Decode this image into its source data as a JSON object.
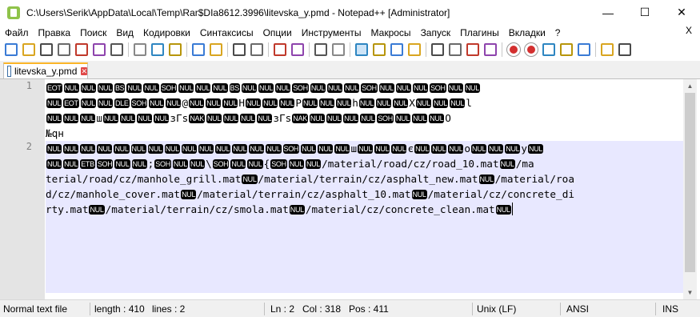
{
  "window": {
    "title": "C:\\Users\\Serik\\AppData\\Local\\Temp\\Rar$DIa8612.3996\\litevska_y.pmd - Notepad++ [Administrator]",
    "minimize": "—",
    "maximize": "☐",
    "close": "✕"
  },
  "menu": {
    "items": [
      "Файл",
      "Правка",
      "Поиск",
      "Вид",
      "Кодировки",
      "Синтаксисы",
      "Опции",
      "Инструменты",
      "Макросы",
      "Запуск",
      "Плагины",
      "Вкладки",
      "?"
    ],
    "close_doc": "X"
  },
  "toolbar": {
    "icons": [
      "new-file-icon",
      "open-file-icon",
      "save-icon",
      "save-all-icon",
      "close-icon",
      "close-all-icon",
      "print-icon",
      "cut-icon",
      "copy-icon",
      "paste-icon",
      "undo-icon",
      "redo-icon",
      "find-icon",
      "replace-icon",
      "zoom-in-icon",
      "zoom-out-icon",
      "sync-vertical-icon",
      "sync-horizontal-icon",
      "word-wrap-icon",
      "show-all-chars-icon",
      "indent-guide-icon",
      "udl-icon",
      "doc-map-icon",
      "function-list-icon",
      "folder-as-workspace-icon",
      "monitoring-icon",
      "record-macro-icon",
      "stop-record-icon",
      "play-macro-icon",
      "play-multiple-icon",
      "save-macro-icon",
      "spell-check-icon",
      "plugin-icon"
    ],
    "accent": "#2b6cb0"
  },
  "tab": {
    "label": "litevska_y.pmd",
    "close": "✕"
  },
  "editor": {
    "line_numbers": [
      "1",
      "2"
    ],
    "rows": [
      [
        [
          "c",
          "EOT"
        ],
        [
          "c",
          "NUL"
        ],
        [
          "c",
          "NUL"
        ],
        [
          "c",
          "NUL"
        ],
        [
          "c",
          "BS"
        ],
        [
          "c",
          "NUL"
        ],
        [
          "c",
          "NUL"
        ],
        [
          "c",
          "SOH"
        ],
        [
          "c",
          "NUL"
        ],
        [
          "c",
          "NUL"
        ],
        [
          "c",
          "NUL"
        ],
        [
          "c",
          "BS"
        ],
        [
          "c",
          "NUL"
        ],
        [
          "c",
          "NUL"
        ],
        [
          "c",
          "NUL"
        ],
        [
          "c",
          "SOH"
        ],
        [
          "c",
          "NUL"
        ],
        [
          "c",
          "NUL"
        ],
        [
          "c",
          "NUL"
        ],
        [
          "c",
          "SOH"
        ],
        [
          "c",
          "NUL"
        ],
        [
          "c",
          "NUL"
        ],
        [
          "c",
          "NUL"
        ],
        [
          "c",
          "SOH"
        ],
        [
          "c",
          "NUL"
        ],
        [
          "c",
          "NUL"
        ]
      ],
      [
        [
          "c",
          "NUL"
        ],
        [
          "c",
          "EOT"
        ],
        [
          "c",
          "NUL"
        ],
        [
          "c",
          "NUL"
        ],
        [
          "c",
          "DLE"
        ],
        [
          "c",
          "SOH"
        ],
        [
          "c",
          "NUL"
        ],
        [
          "c",
          "NUL"
        ],
        [
          "t",
          "@"
        ],
        [
          "c",
          "NUL"
        ],
        [
          "c",
          "NUL"
        ],
        [
          "c",
          "NUL"
        ],
        [
          "t",
          "H"
        ],
        [
          "c",
          "NUL"
        ],
        [
          "c",
          "NUL"
        ],
        [
          "c",
          "NUL"
        ],
        [
          "t",
          "P"
        ],
        [
          "c",
          "NUL"
        ],
        [
          "c",
          "NUL"
        ],
        [
          "c",
          "NUL"
        ],
        [
          "t",
          "h"
        ],
        [
          "c",
          "NUL"
        ],
        [
          "c",
          "NUL"
        ],
        [
          "c",
          "NUL"
        ],
        [
          "t",
          "X"
        ],
        [
          "c",
          "NUL"
        ],
        [
          "c",
          "NUL"
        ],
        [
          "c",
          "NUL"
        ],
        [
          "t",
          "l"
        ]
      ],
      [
        [
          "c",
          "NUL"
        ],
        [
          "c",
          "NUL"
        ],
        [
          "c",
          "NUL"
        ],
        [
          "t",
          "ш"
        ],
        [
          "c",
          "NUL"
        ],
        [
          "c",
          "NUL"
        ],
        [
          "c",
          "NUL"
        ],
        [
          "c",
          "NUL"
        ],
        [
          "t",
          "зГs"
        ],
        [
          "c",
          "NAK"
        ],
        [
          "c",
          "NUL"
        ],
        [
          "c",
          "NUL"
        ],
        [
          "c",
          "NUL"
        ],
        [
          "c",
          "NUL"
        ],
        [
          "t",
          "зГs"
        ],
        [
          "c",
          "NAK"
        ],
        [
          "c",
          "NUL"
        ],
        [
          "c",
          "NUL"
        ],
        [
          "c",
          "NUL"
        ],
        [
          "c",
          "NUL"
        ],
        [
          "c",
          "SOH"
        ],
        [
          "c",
          "NUL"
        ],
        [
          "c",
          "NUL"
        ],
        [
          "c",
          "NUL"
        ],
        [
          "t",
          "O"
        ]
      ],
      [
        [
          "t",
          "№qн"
        ]
      ],
      [
        [
          "c",
          "NUL"
        ],
        [
          "c",
          "NUL"
        ],
        [
          "c",
          "NUL"
        ],
        [
          "c",
          "NUL"
        ],
        [
          "c",
          "NUL"
        ],
        [
          "c",
          "NUL"
        ],
        [
          "c",
          "NUL"
        ],
        [
          "c",
          "NUL"
        ],
        [
          "c",
          "NUL"
        ],
        [
          "c",
          "NUL"
        ],
        [
          "c",
          "NUL"
        ],
        [
          "c",
          "NUL"
        ],
        [
          "c",
          "NUL"
        ],
        [
          "c",
          "NUL"
        ],
        [
          "c",
          "SOH"
        ],
        [
          "c",
          "NUL"
        ],
        [
          "c",
          "NUL"
        ],
        [
          "c",
          "NUL"
        ],
        [
          "t",
          "ш"
        ],
        [
          "c",
          "NUL"
        ],
        [
          "c",
          "NUL"
        ],
        [
          "c",
          "NUL"
        ],
        [
          "t",
          "є"
        ],
        [
          "c",
          "NUL"
        ],
        [
          "c",
          "NUL"
        ],
        [
          "c",
          "NUL"
        ],
        [
          "t",
          "o"
        ],
        [
          "c",
          "NUL"
        ],
        [
          "c",
          "NUL"
        ],
        [
          "c",
          "NUL"
        ],
        [
          "t",
          "y"
        ],
        [
          "c",
          "NUL"
        ]
      ],
      [
        [
          "c",
          "NUL"
        ],
        [
          "c",
          "NUL"
        ],
        [
          "c",
          "ETB"
        ],
        [
          "c",
          "SOH"
        ],
        [
          "c",
          "NUL"
        ],
        [
          "c",
          "NUL"
        ],
        [
          "t",
          ";"
        ],
        [
          "c",
          "SOH"
        ],
        [
          "c",
          "NUL"
        ],
        [
          "c",
          "NUL"
        ],
        [
          "t",
          "\\"
        ],
        [
          "c",
          "SOH"
        ],
        [
          "c",
          "NUL"
        ],
        [
          "c",
          "NUL"
        ],
        [
          "t",
          "{"
        ],
        [
          "c",
          "SOH"
        ],
        [
          "c",
          "NUL"
        ],
        [
          "c",
          "NUL"
        ],
        [
          "t",
          "/material/road/cz/road_10.mat"
        ],
        [
          "c",
          "NUL"
        ],
        [
          "t",
          "/ma"
        ]
      ],
      [
        [
          "t",
          "terial/road/cz/manhole_grill.mat"
        ],
        [
          "c",
          "NUL"
        ],
        [
          "t",
          "/material/terrain/cz/asphalt_new.mat"
        ],
        [
          "c",
          "NUL"
        ],
        [
          "t",
          "/material/roa"
        ]
      ],
      [
        [
          "t",
          "d/cz/manhole_cover.mat"
        ],
        [
          "c",
          "NUL"
        ],
        [
          "t",
          "/material/terrain/cz/asphalt_10.mat"
        ],
        [
          "c",
          "NUL"
        ],
        [
          "t",
          "/material/cz/concrete_di"
        ]
      ],
      [
        [
          "t",
          "rty.mat"
        ],
        [
          "c",
          "NUL"
        ],
        [
          "t",
          "/material/terrain/cz/smola.mat"
        ],
        [
          "c",
          "NUL"
        ],
        [
          "t",
          "/material/cz/concrete_clean.mat"
        ],
        [
          "c",
          "NUL"
        ]
      ]
    ]
  },
  "status": {
    "type": "Normal text file",
    "length": "length : 410",
    "lines": "lines : 2",
    "ln": "Ln : 2",
    "col": "Col : 318",
    "pos": "Pos : 411",
    "eol": "Unix (LF)",
    "encoding": "ANSI",
    "mode": "INS"
  }
}
